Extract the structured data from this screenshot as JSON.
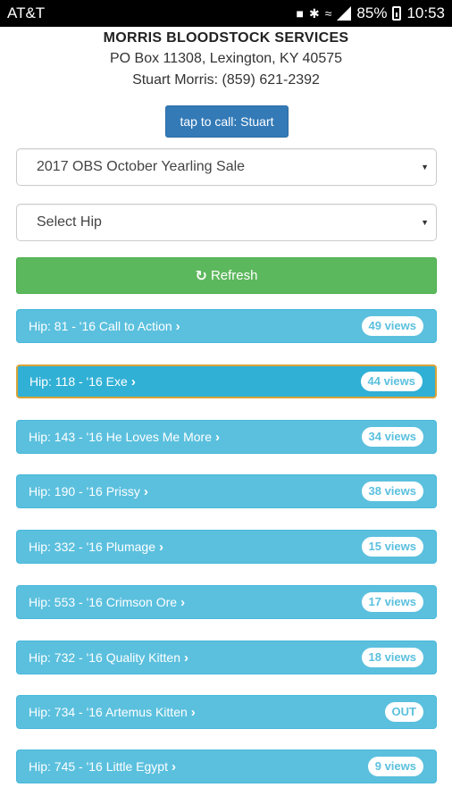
{
  "status_bar": {
    "carrier": "AT&T",
    "battery": "85%",
    "time": "10:53"
  },
  "header": {
    "company": "MORRIS BLOODSTOCK SERVICES",
    "address": "PO Box 11308, Lexington, KY 40575",
    "contact": "Stuart Morris: (859) 621-2392"
  },
  "call_button": {
    "label": "tap to call: Stuart"
  },
  "sale_select": {
    "selected": "2017 OBS October Yearling Sale"
  },
  "hip_select": {
    "selected": "Select Hip"
  },
  "refresh_button": {
    "label": "Refresh"
  },
  "hips": [
    {
      "label": "Hip: 81 - '16 Call to Action",
      "badge": "49 views",
      "active": false
    },
    {
      "label": "Hip: 118 - '16 Exe",
      "badge": "44 views",
      "active": true
    },
    {
      "label": "Hip: 143 - '16 He Loves Me More",
      "badge": "34 views",
      "active": false
    },
    {
      "label": "Hip: 190 - '16 Prissy",
      "badge": "38 views",
      "active": false
    },
    {
      "label": "Hip: 332 - '16 Plumage",
      "badge": "15 views",
      "active": false
    },
    {
      "label": "Hip: 553 - '16 Crimson Ore",
      "badge": "17 views",
      "active": false
    },
    {
      "label": "Hip: 732 - '16 Quality Kitten",
      "badge": "18 views",
      "active": false
    },
    {
      "label": "Hip: 734 - '16 Artemus Kitten",
      "badge": "OUT",
      "active": false
    },
    {
      "label": "Hip: 745 - '16 Little Egypt",
      "badge": "9 views",
      "active": false
    }
  ]
}
